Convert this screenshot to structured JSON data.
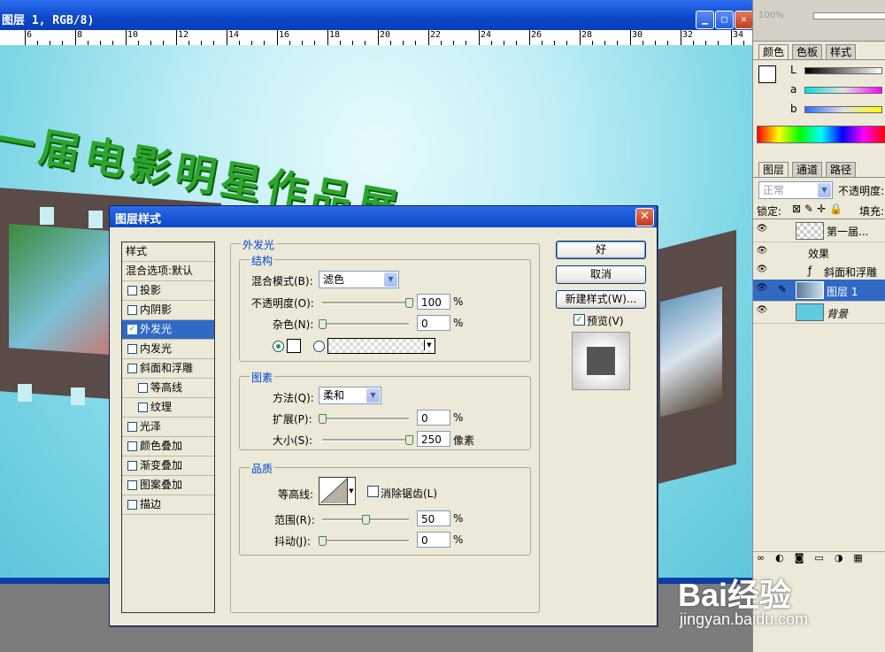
{
  "document": {
    "title": "图层 1, RGB/8)",
    "ruler_marks": [
      "6",
      "8",
      "10",
      "12",
      "14",
      "16",
      "18",
      "20",
      "22",
      "24",
      "26",
      "28",
      "30",
      "32",
      "34"
    ],
    "canvas_text": "一届电影明星作品展"
  },
  "panels": {
    "navigator_zoom": "100%",
    "color_tabs": [
      "颜色",
      "色板",
      "样式"
    ],
    "color_labels": [
      "L",
      "a",
      "b"
    ],
    "layers_tabs": [
      "图层",
      "通道",
      "路径"
    ],
    "blend_mode": "正常",
    "opacity_label": "不透明度:",
    "lock_label": "锁定:",
    "fill_label": "填充:",
    "layers": [
      {
        "name": "第一届..."
      },
      {
        "name": "效果"
      },
      {
        "name": "斜面和浮雕"
      },
      {
        "name": "图层 1"
      },
      {
        "name": "背景"
      }
    ]
  },
  "dialog": {
    "title": "图层样式",
    "style_list": [
      {
        "label": "样式",
        "checkbox": false
      },
      {
        "label": "混合选项:默认",
        "checkbox": false
      },
      {
        "label": "投影",
        "checkbox": true,
        "checked": false
      },
      {
        "label": "内阴影",
        "checkbox": true,
        "checked": false
      },
      {
        "label": "外发光",
        "checkbox": true,
        "checked": true,
        "selected": true
      },
      {
        "label": "内发光",
        "checkbox": true,
        "checked": false
      },
      {
        "label": "斜面和浮雕",
        "checkbox": true,
        "checked": false
      },
      {
        "label": "等高线",
        "checkbox": true,
        "checked": false,
        "indent": true
      },
      {
        "label": "纹理",
        "checkbox": true,
        "checked": false,
        "indent": true
      },
      {
        "label": "光泽",
        "checkbox": true,
        "checked": false
      },
      {
        "label": "颜色叠加",
        "checkbox": true,
        "checked": false
      },
      {
        "label": "渐变叠加",
        "checkbox": true,
        "checked": false
      },
      {
        "label": "图案叠加",
        "checkbox": true,
        "checked": false
      },
      {
        "label": "描边",
        "checkbox": true,
        "checked": false
      }
    ],
    "section_title": "外发光",
    "structure": {
      "title": "结构",
      "blend_mode_label": "混合模式(B):",
      "blend_mode_value": "滤色",
      "opacity_label": "不透明度(O):",
      "opacity_value": "100",
      "opacity_pct": 1.0,
      "noise_label": "杂色(N):",
      "noise_value": "0",
      "noise_pct": 0.0,
      "percent": "%"
    },
    "elements": {
      "title": "图素",
      "technique_label": "方法(Q):",
      "technique_value": "柔和",
      "spread_label": "扩展(P):",
      "spread_value": "0",
      "spread_pct": 0.0,
      "size_label": "大小(S):",
      "size_value": "250",
      "size_pct": 1.0,
      "size_unit": "像素",
      "percent": "%"
    },
    "quality": {
      "title": "品质",
      "contour_label": "等高线:",
      "antialias_label": "消除锯齿(L)",
      "range_label": "范围(R):",
      "range_value": "50",
      "range_pct": 0.5,
      "jitter_label": "抖动(J):",
      "jitter_value": "0",
      "jitter_pct": 0.0,
      "percent": "%"
    },
    "buttons": {
      "ok": "好",
      "cancel": "取消",
      "new_style": "新建样式(W)...",
      "preview": "预览(V)"
    }
  },
  "watermark": {
    "brand": "Bai经验",
    "url": "jingyan.baidu.com"
  }
}
